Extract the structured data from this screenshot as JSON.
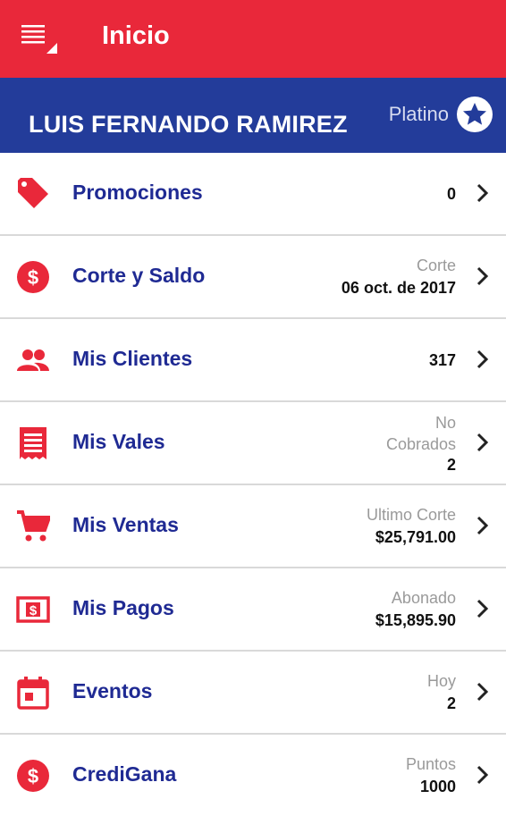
{
  "colors": {
    "appbar": "#e9283a",
    "userbar": "#233c9a",
    "label": "#1f2a93",
    "icon": "#e9283a"
  },
  "appbar": {
    "title": "Inicio",
    "menu_icon": "menu-icon"
  },
  "user": {
    "name": "LUIS FERNANDO RAMIREZ",
    "tier": "Platino",
    "tier_icon": "star-icon"
  },
  "items": [
    {
      "label": "Promociones",
      "icon": "tag-icon",
      "caption": "",
      "value": "0"
    },
    {
      "label": "Corte y Saldo",
      "icon": "dollar-icon",
      "caption": "Corte",
      "value": "06 oct. de 2017"
    },
    {
      "label": "Mis Clientes",
      "icon": "people-icon",
      "caption": "",
      "value": "317"
    },
    {
      "label": "Mis Vales",
      "icon": "receipt-icon",
      "caption_line1": "No",
      "caption": "Cobrados",
      "value": "2"
    },
    {
      "label": "Mis Ventas",
      "icon": "cart-icon",
      "caption": "Ultimo Corte",
      "value": "$25,791.00"
    },
    {
      "label": "Mis Pagos",
      "icon": "payment-icon",
      "caption": "Abonado",
      "value": "$15,895.90"
    },
    {
      "label": "Eventos",
      "icon": "calendar-icon",
      "caption": "Hoy",
      "value": "2"
    },
    {
      "label": "CrediGana",
      "icon": "dollar-icon",
      "caption": "Puntos",
      "value": "1000"
    }
  ]
}
